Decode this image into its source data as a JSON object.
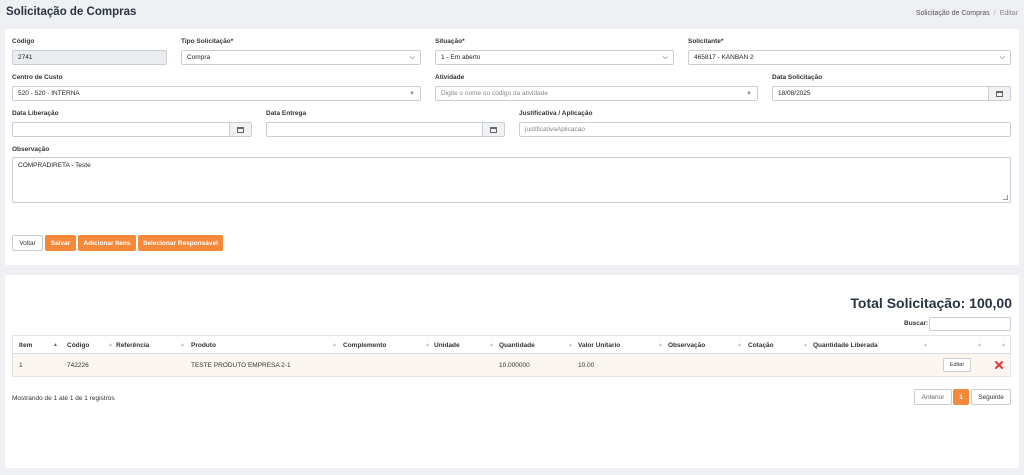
{
  "header": {
    "title": "Solicitação de Compras",
    "breadcrumb": [
      "Solicitação de Compras",
      "/",
      "Editar"
    ]
  },
  "form": {
    "codigo": {
      "label": "Código",
      "value": "2741"
    },
    "tipo": {
      "label": "Tipo Solicitação*",
      "value": "Compra"
    },
    "situacao": {
      "label": "Situação*",
      "value": "1 - Em aberto"
    },
    "solicitante": {
      "label": "Solicitante*",
      "value": "465817 - KANBAN 2"
    },
    "centro_custo": {
      "label": "Centro de Custo",
      "value": "520 - 520 - INTERNA"
    },
    "atividade": {
      "label": "Atividade",
      "placeholder": "Digite o nome ou código da atividade"
    },
    "data_solicitacao": {
      "label": "Data Solicitação",
      "value": "18/08/2025"
    },
    "data_liberacao": {
      "label": "Data Liberação",
      "value": ""
    },
    "data_entrega": {
      "label": "Data Entrega",
      "value": ""
    },
    "justificativa": {
      "label": "Justificativa / Aplicação",
      "placeholder": "justificativaAplicacao"
    },
    "observacao": {
      "label": "Observação",
      "value": "COMPRADIRETA - Teste"
    }
  },
  "actions": {
    "voltar": "Voltar",
    "salvar": "Salvar",
    "adicionar": "Adicionar Itens",
    "selecionar": "Selecionar Responsável"
  },
  "colors": {
    "accent": "#f6883a",
    "delete": "#e53935"
  },
  "items": {
    "total": "Total Solicitação: 100,00",
    "search_label": "Buscar:",
    "columns": [
      "Item",
      "Código",
      "Referência",
      "Produto",
      "Complemento",
      "Unidade",
      "Quantidade",
      "Valor Unitario",
      "Observação",
      "Cotação",
      "Quantidade Liberada"
    ],
    "rows": [
      {
        "item": "1",
        "codigo": "742226",
        "referencia": "",
        "produto": "TESTE PRODUTO EMPRESA 2-1",
        "complemento": "",
        "unidade": "",
        "quantidade": "10.000000",
        "valor": "10.00",
        "observacao": "",
        "cotacao": "",
        "quantidade_liberada": "",
        "edit_label": "Editar",
        "delete_icon": "close-icon"
      }
    ],
    "info": "Mostrando de 1 até 1 de 1 registros",
    "pagination": {
      "prev": "Anterior",
      "page": "1",
      "next": "Seguinte"
    }
  }
}
